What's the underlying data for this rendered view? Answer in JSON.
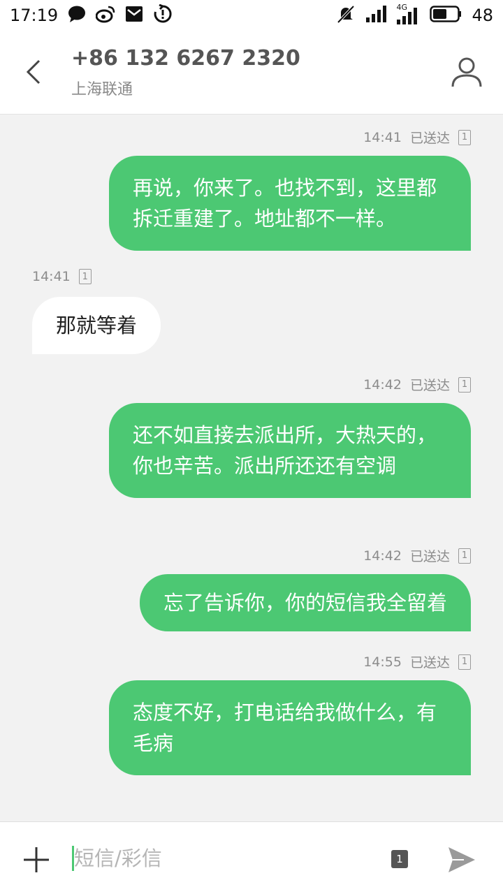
{
  "status_bar": {
    "time": "17:19",
    "network": "4G",
    "battery": "48",
    "icons": [
      "chat-bubble-icon",
      "weibo-icon",
      "mail-icon",
      "sync-icon",
      "muted-bell-icon",
      "signal-icon",
      "signal-4g-icon",
      "battery-icon"
    ]
  },
  "header": {
    "number": "+86 132 6267 2320",
    "carrier": "上海联通",
    "back_icon": "chevron-left-icon",
    "profile_icon": "person-icon"
  },
  "messages": [
    {
      "direction": "out",
      "time": "14:41",
      "status": "已送达",
      "sim": "1",
      "text": "再说，你来了。也找不到，这里都拆迁重建了。地址都不一样。"
    },
    {
      "direction": "in",
      "time": "14:41",
      "status": "",
      "sim": "1",
      "text": "那就等着"
    },
    {
      "direction": "out",
      "time": "14:42",
      "status": "已送达",
      "sim": "1",
      "text": "还不如直接去派出所，大热天的，你也辛苦。派出所还还有空调"
    },
    {
      "direction": "out",
      "time": "14:42",
      "status": "已送达",
      "sim": "1",
      "text": "忘了告诉你，你的短信我全留着"
    },
    {
      "direction": "out",
      "time": "14:55",
      "status": "已送达",
      "sim": "1",
      "text": "态度不好，打电话给我做什么，有毛病"
    }
  ],
  "composer": {
    "placeholder": "短信/彩信",
    "sim": "1",
    "add_icon": "plus-icon",
    "send_icon": "send-icon"
  },
  "colors": {
    "outgoing_bubble": "#4cc873",
    "incoming_bubble": "#ffffff",
    "background": "#f2f2f2"
  }
}
